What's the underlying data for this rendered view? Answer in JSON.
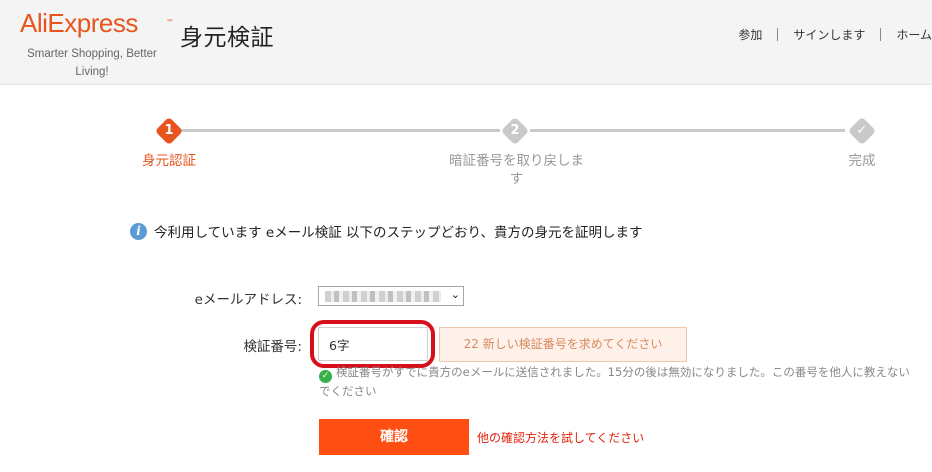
{
  "header": {
    "logo": "AliExpress",
    "logo_tm": "™",
    "tagline": "Smarter Shopping, Better Living!",
    "title": "身元検証",
    "nav": {
      "join": "参加",
      "signin": "サインします",
      "home": "ホーム"
    }
  },
  "steps": [
    {
      "number": "1",
      "label": "身元認証",
      "state": "active"
    },
    {
      "number": "2",
      "label": "暗証番号を取り戻します",
      "state": "pending"
    },
    {
      "number": "✓",
      "label": "完成",
      "state": "pending"
    }
  ],
  "info": {
    "icon": "info-icon",
    "text": "今利用しています eメール検証 以下のステップどおり、貴方の身元を証明します"
  },
  "form": {
    "email_label": "eメールアドレス:",
    "code_label": "検証番号:",
    "code_value": "6字",
    "resend_label": "22 新しい検証番号を求めてください",
    "sent_message": "検証番号がすでに貴方のeメールに送信されました。15分の後は無効になりました。この番号を他人に教えないでください",
    "confirm_label": "確認",
    "other_method_label": "他の確認方法を試してください"
  },
  "colors": {
    "brand": "#e8541e",
    "primary_button": "#ff4e11",
    "step_active": "#e8541e",
    "step_pending": "#c9c9c9",
    "highlight_ring": "#d6101b",
    "link": "#e3230a"
  }
}
